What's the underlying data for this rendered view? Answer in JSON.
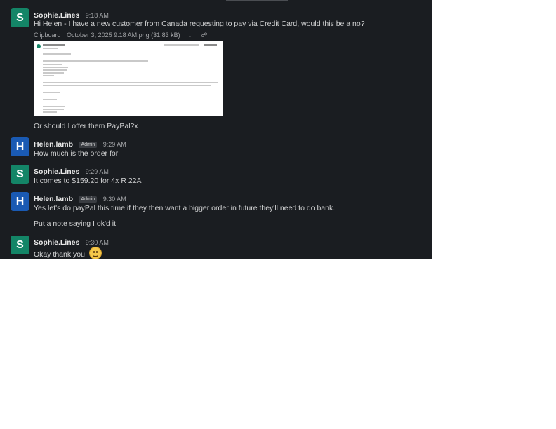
{
  "messages": [
    {
      "avatar": "S",
      "name": "Sophie.Lines",
      "time": "9:18 AM",
      "lines": [
        "Hi Helen - I have a new customer from Canada requesting to pay via Credit Card, would this be a no?"
      ],
      "attachment": {
        "source": "Clipboard",
        "filename": "October 3, 2025 9:18 AM.png (31.83 kB)",
        "icons": [
          "chevron-down-icon",
          "link-icon"
        ]
      },
      "after_lines": [
        "Or should I offer them PayPal?x"
      ]
    },
    {
      "avatar": "H",
      "name": "Helen.lamb",
      "badge": "Admin",
      "time": "9:29 AM",
      "lines": [
        "How much is the order for"
      ]
    },
    {
      "avatar": "S",
      "name": "Sophie.Lines",
      "time": "9:29 AM",
      "lines": [
        "It comes to $159.20 for 4x R 22A"
      ]
    },
    {
      "avatar": "H",
      "name": "Helen.lamb",
      "badge": "Admin",
      "time": "9:30 AM",
      "lines": [
        "Yes let's do payPal this time if they then want a bigger order in future they'll need to do bank.",
        "Put a note saying I ok'd it"
      ]
    },
    {
      "avatar": "S",
      "name": "Sophie.Lines",
      "time": "9:30 AM",
      "lines": [
        "Okay thank you"
      ],
      "emoji": "slightly-smiling-face-icon"
    }
  ],
  "colors": {
    "background": "#1a1d21",
    "sophie_avatar": "#148567",
    "helen_avatar": "#1a5ab3"
  }
}
